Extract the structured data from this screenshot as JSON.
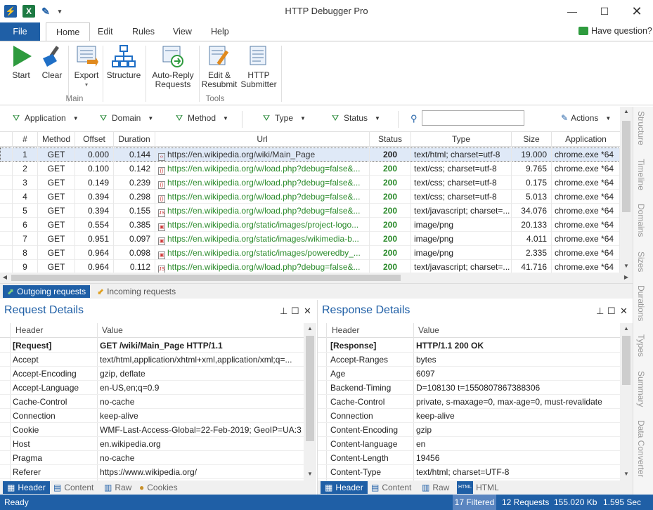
{
  "window": {
    "title": "HTTP Debugger Pro"
  },
  "ribbon_tabs": [
    "File",
    "Home",
    "Edit",
    "Rules",
    "View",
    "Help"
  ],
  "help_link": "Have question?",
  "ribbon": {
    "buttons": [
      {
        "label": "Start",
        "icon": "play-icon"
      },
      {
        "label": "Clear",
        "icon": "broom-icon"
      },
      {
        "label": "Export",
        "icon": "export-icon"
      },
      {
        "label": "Structure",
        "icon": "structure-icon"
      },
      {
        "label": "Auto-Reply\nRequests",
        "icon": "auto-reply-icon"
      },
      {
        "label": "Edit &\nResubmit",
        "icon": "edit-resubmit-icon"
      },
      {
        "label": "HTTP\nSubmitter",
        "icon": "http-submitter-icon"
      }
    ],
    "groups": [
      "Main",
      "Tools"
    ]
  },
  "filters": [
    "Application",
    "Domain",
    "Method",
    "Type",
    "Status"
  ],
  "actions_label": "Actions",
  "search": {
    "value": "",
    "placeholder": ""
  },
  "grid": {
    "columns": [
      "#",
      "Method",
      "Offset",
      "Duration",
      "Url",
      "Status",
      "Type",
      "Size",
      "Application"
    ],
    "rows": [
      {
        "n": "1",
        "method": "GET",
        "offset": "0.000",
        "duration": "0.144",
        "icon": "html-file-icon",
        "url": "https://en.wikipedia.org/wiki/Main_Page",
        "status": "200",
        "type": "text/html; charset=utf-8",
        "size": "19.000",
        "app": "chrome.exe *64"
      },
      {
        "n": "2",
        "method": "GET",
        "offset": "0.100",
        "duration": "0.142",
        "icon": "css-file-icon",
        "url": "https://en.wikipedia.org/w/load.php?debug=false&...",
        "status": "200",
        "type": "text/css; charset=utf-8",
        "size": "9.765",
        "app": "chrome.exe *64"
      },
      {
        "n": "3",
        "method": "GET",
        "offset": "0.149",
        "duration": "0.239",
        "icon": "css-file-icon",
        "url": "https://en.wikipedia.org/w/load.php?debug=false&...",
        "status": "200",
        "type": "text/css; charset=utf-8",
        "size": "0.175",
        "app": "chrome.exe *64"
      },
      {
        "n": "4",
        "method": "GET",
        "offset": "0.394",
        "duration": "0.298",
        "icon": "css-file-icon",
        "url": "https://en.wikipedia.org/w/load.php?debug=false&...",
        "status": "200",
        "type": "text/css; charset=utf-8",
        "size": "5.013",
        "app": "chrome.exe *64"
      },
      {
        "n": "5",
        "method": "GET",
        "offset": "0.394",
        "duration": "0.155",
        "icon": "js-file-icon",
        "url": "https://en.wikipedia.org/w/load.php?debug=false&...",
        "status": "200",
        "type": "text/javascript; charset=...",
        "size": "34.076",
        "app": "chrome.exe *64"
      },
      {
        "n": "6",
        "method": "GET",
        "offset": "0.554",
        "duration": "0.385",
        "icon": "image-file-icon",
        "url": "https://en.wikipedia.org/static/images/project-logo...",
        "status": "200",
        "type": "image/png",
        "size": "20.133",
        "app": "chrome.exe *64"
      },
      {
        "n": "7",
        "method": "GET",
        "offset": "0.951",
        "duration": "0.097",
        "icon": "image-file-icon",
        "url": "https://en.wikipedia.org/static/images/wikimedia-b...",
        "status": "200",
        "type": "image/png",
        "size": "4.011",
        "app": "chrome.exe *64"
      },
      {
        "n": "8",
        "method": "GET",
        "offset": "0.964",
        "duration": "0.098",
        "icon": "image-file-icon",
        "url": "https://en.wikipedia.org/static/images/poweredby_...",
        "status": "200",
        "type": "image/png",
        "size": "2.335",
        "app": "chrome.exe *64"
      },
      {
        "n": "9",
        "method": "GET",
        "offset": "0.964",
        "duration": "0.112",
        "icon": "js-file-icon",
        "url": "https://en.wikipedia.org/w/load.php?debug=false&...",
        "status": "200",
        "type": "text/javascript; charset=...",
        "size": "41.716",
        "app": "chrome.exe *64"
      }
    ]
  },
  "direction_tabs": [
    "Outgoing requests",
    "Incoming requests"
  ],
  "request": {
    "title": "Request Details",
    "columns": [
      "Header",
      "Value"
    ],
    "rows": [
      {
        "k": "[Request]",
        "v": "GET /wiki/Main_Page HTTP/1.1",
        "bold": true
      },
      {
        "k": "Accept",
        "v": "text/html,application/xhtml+xml,application/xml;q=..."
      },
      {
        "k": "Accept-Encoding",
        "v": "gzip, deflate"
      },
      {
        "k": "Accept-Language",
        "v": "en-US,en;q=0.9"
      },
      {
        "k": "Cache-Control",
        "v": "no-cache"
      },
      {
        "k": "Connection",
        "v": "keep-alive"
      },
      {
        "k": "Cookie",
        "v": "WMF-Last-Access-Global=22-Feb-2019; GeoIP=UA:3..."
      },
      {
        "k": "Host",
        "v": "en.wikipedia.org"
      },
      {
        "k": "Pragma",
        "v": "no-cache"
      },
      {
        "k": "Referer",
        "v": "https://www.wikipedia.org/"
      }
    ],
    "tabs": [
      "Header",
      "Content",
      "Raw",
      "Cookies"
    ]
  },
  "response": {
    "title": "Response Details",
    "columns": [
      "Header",
      "Value"
    ],
    "rows": [
      {
        "k": "[Response]",
        "v": "HTTP/1.1 200 OK",
        "bold": true
      },
      {
        "k": "Accept-Ranges",
        "v": "bytes"
      },
      {
        "k": "Age",
        "v": "6097"
      },
      {
        "k": "Backend-Timing",
        "v": "D=108130 t=1550807867388306"
      },
      {
        "k": "Cache-Control",
        "v": "private, s-maxage=0, max-age=0, must-revalidate"
      },
      {
        "k": "Connection",
        "v": "keep-alive"
      },
      {
        "k": "Content-Encoding",
        "v": "gzip"
      },
      {
        "k": "Content-language",
        "v": "en"
      },
      {
        "k": "Content-Length",
        "v": "19456"
      },
      {
        "k": "Content-Type",
        "v": "text/html; charset=UTF-8"
      }
    ],
    "tabs": [
      "Header",
      "Content",
      "Raw",
      "HTML"
    ]
  },
  "sidebar_tabs": [
    "Structure",
    "Timeline",
    "Domains",
    "Sizes",
    "Durations",
    "Types",
    "Summary",
    "Data Converter"
  ],
  "statusbar": {
    "left": "Ready",
    "filtered": "17 Filtered",
    "requests": "12 Requests",
    "kb": "155.020 Kb",
    "sec": "1.595 Sec"
  },
  "colors": {
    "accent": "#1f5fa6",
    "status_ok": "#2a8a2a",
    "url": "#2a8a2a"
  }
}
